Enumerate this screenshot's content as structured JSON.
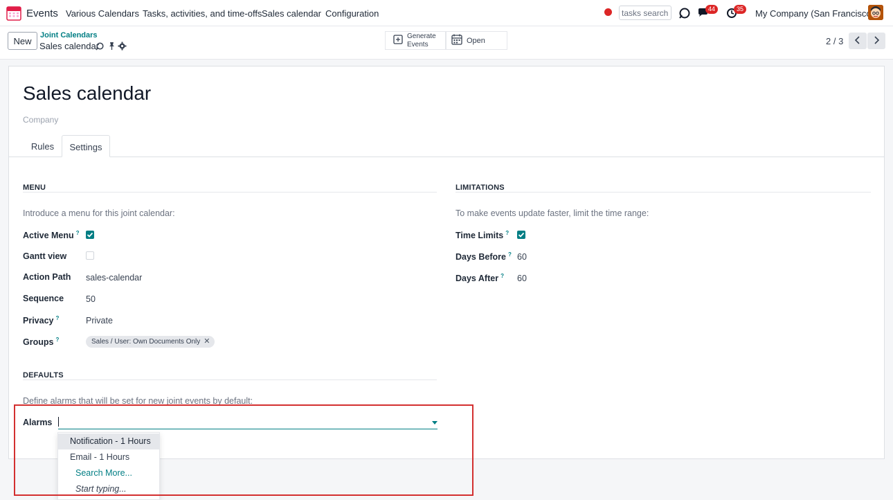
{
  "topnav": {
    "app_name": "Events",
    "menu": [
      "Various Calendars",
      "Tasks, activities, and time-offs",
      "Sales calendar",
      "Configuration"
    ],
    "search_value": "tasks search",
    "chat_count": "44",
    "activity_count": "35",
    "company": "My Company (San Francisco)",
    "accent_color": "#017e84",
    "alert_color": "#dc2626"
  },
  "control_panel": {
    "new_label": "New",
    "breadcrumb_parent": "Joint Calendars",
    "breadcrumb_current": "Sales calendar",
    "generate_label_1": "Generate",
    "generate_label_2": "Events",
    "open_label": "Open",
    "pager": "2 / 3"
  },
  "form": {
    "title": "Sales calendar",
    "company_placeholder": "Company",
    "tabs": [
      "Rules",
      "Settings"
    ],
    "active_tab": "Settings",
    "menu_section": {
      "title": "MENU",
      "hint": "Introduce a menu for this joint calendar:",
      "active_menu_label": "Active Menu",
      "active_menu_checked": true,
      "gantt_label": "Gantt view",
      "gantt_checked": false,
      "action_path_label": "Action Path",
      "action_path_value": "sales-calendar",
      "sequence_label": "Sequence",
      "sequence_value": "50",
      "privacy_label": "Privacy",
      "privacy_value": "Private",
      "groups_label": "Groups",
      "groups_tag": "Sales / User: Own Documents Only"
    },
    "limitations_section": {
      "title": "LIMITATIONS",
      "hint": "To make events update faster, limit the time range:",
      "time_limits_label": "Time Limits",
      "time_limits_checked": true,
      "days_before_label": "Days Before",
      "days_before_value": "60",
      "days_after_label": "Days After",
      "days_after_value": "60"
    },
    "defaults_section": {
      "title": "DEFAULTS",
      "hint": "Define alarms that will be set for new joint events by default:",
      "alarms_label": "Alarms",
      "alarms_value": ""
    },
    "alarm_dropdown": {
      "options": [
        "Notification - 1 Hours",
        "Email - 1 Hours"
      ],
      "search_more": "Search More...",
      "start_typing": "Start typing..."
    }
  }
}
